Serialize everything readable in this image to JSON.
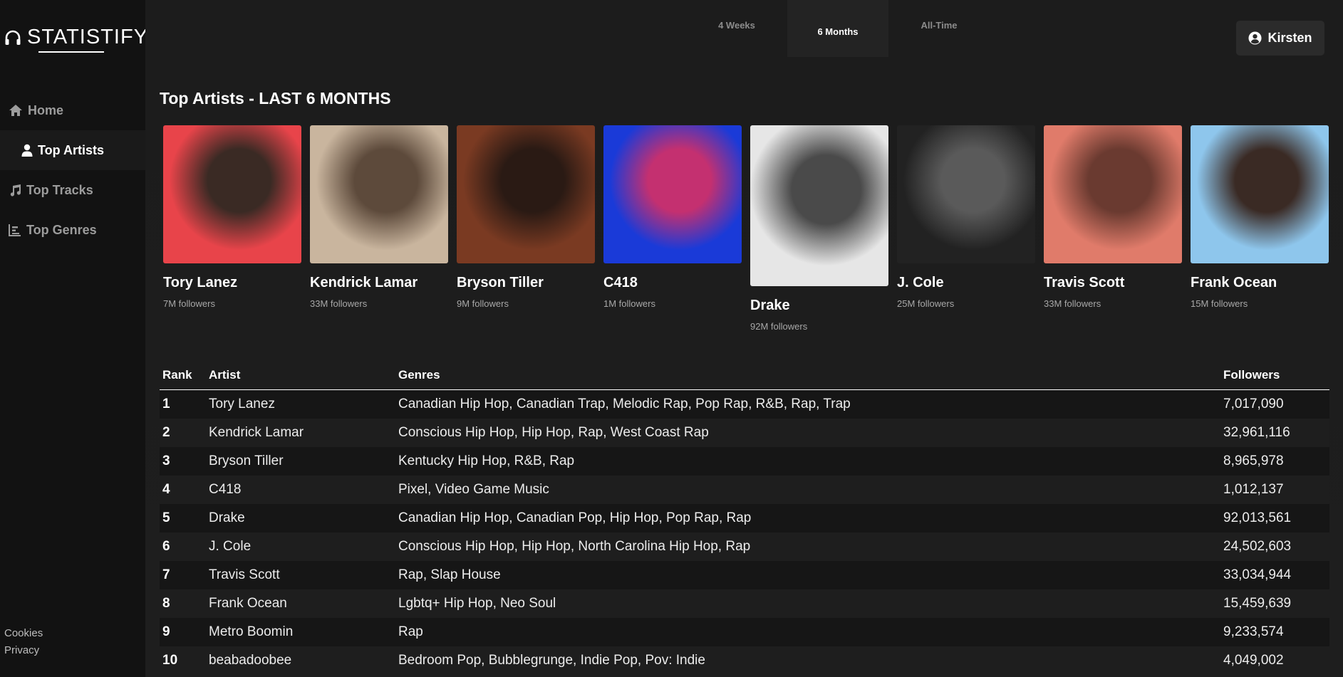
{
  "app": {
    "name": "STATISTIFY"
  },
  "sidebar": {
    "items": [
      {
        "label": "Home",
        "icon": "home-icon"
      },
      {
        "label": "Top Artists",
        "icon": "user-icon"
      },
      {
        "label": "Top Tracks",
        "icon": "music-note-icon"
      },
      {
        "label": "Top Genres",
        "icon": "bar-chart-icon"
      }
    ],
    "active_index": 1,
    "footer": [
      "Cookies",
      "Privacy"
    ]
  },
  "time_tabs": {
    "items": [
      "4 Weeks",
      "6 Months",
      "All-Time"
    ],
    "active_index": 1
  },
  "user": {
    "name": "Kirsten"
  },
  "page": {
    "title": "Top Artists - LAST 6 MONTHS"
  },
  "cards": [
    {
      "name": "Tory Lanez",
      "followers": "7M followers",
      "colors": [
        "#e8444a",
        "#3a2a24"
      ]
    },
    {
      "name": "Kendrick Lamar",
      "followers": "33M followers",
      "colors": [
        "#c9b59e",
        "#5d4a3b"
      ]
    },
    {
      "name": "Bryson Tiller",
      "followers": "9M followers",
      "colors": [
        "#7a3a22",
        "#2a1a14"
      ]
    },
    {
      "name": "C418",
      "followers": "1M followers",
      "colors": [
        "#1a3ad8",
        "#c43070"
      ]
    },
    {
      "name": "Drake",
      "followers": "92M followers",
      "colors": [
        "#e6e6e6",
        "#4a4a4a"
      ]
    },
    {
      "name": "J. Cole",
      "followers": "25M followers",
      "colors": [
        "#222222",
        "#5a5a5a"
      ]
    },
    {
      "name": "Travis Scott",
      "followers": "33M followers",
      "colors": [
        "#e07b6a",
        "#6a3a30"
      ]
    },
    {
      "name": "Frank Ocean",
      "followers": "15M followers",
      "colors": [
        "#8ec6ec",
        "#3a2a24"
      ]
    }
  ],
  "table": {
    "headers": {
      "rank": "Rank",
      "artist": "Artist",
      "genres": "Genres",
      "followers": "Followers"
    },
    "rows": [
      {
        "rank": "1",
        "artist": "Tory Lanez",
        "genres": "Canadian Hip Hop, Canadian Trap, Melodic Rap, Pop Rap, R&B, Rap, Trap",
        "followers": "7,017,090"
      },
      {
        "rank": "2",
        "artist": "Kendrick Lamar",
        "genres": "Conscious Hip Hop, Hip Hop, Rap, West Coast Rap",
        "followers": "32,961,116"
      },
      {
        "rank": "3",
        "artist": "Bryson Tiller",
        "genres": "Kentucky Hip Hop, R&B, Rap",
        "followers": "8,965,978"
      },
      {
        "rank": "4",
        "artist": "C418",
        "genres": "Pixel, Video Game Music",
        "followers": "1,012,137"
      },
      {
        "rank": "5",
        "artist": "Drake",
        "genres": "Canadian Hip Hop, Canadian Pop, Hip Hop, Pop Rap, Rap",
        "followers": "92,013,561"
      },
      {
        "rank": "6",
        "artist": "J. Cole",
        "genres": "Conscious Hip Hop, Hip Hop, North Carolina Hip Hop, Rap",
        "followers": "24,502,603"
      },
      {
        "rank": "7",
        "artist": "Travis Scott",
        "genres": "Rap, Slap House",
        "followers": "33,034,944"
      },
      {
        "rank": "8",
        "artist": "Frank Ocean",
        "genres": "Lgbtq+ Hip Hop, Neo Soul",
        "followers": "15,459,639"
      },
      {
        "rank": "9",
        "artist": "Metro Boomin",
        "genres": "Rap",
        "followers": "9,233,574"
      },
      {
        "rank": "10",
        "artist": "beabadoobee",
        "genres": "Bedroom Pop, Bubblegrunge, Indie Pop, Pov: Indie",
        "followers": "4,049,002"
      }
    ]
  }
}
